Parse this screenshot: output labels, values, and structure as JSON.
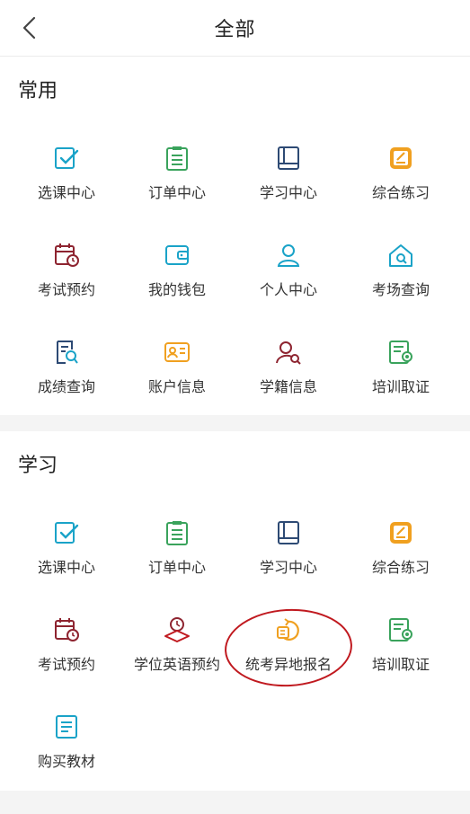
{
  "header": {
    "title": "全部"
  },
  "sections": [
    {
      "title": "常用",
      "items": [
        {
          "label": "选课中心",
          "icon": "checkbox-icon"
        },
        {
          "label": "订单中心",
          "icon": "clipboard-icon"
        },
        {
          "label": "学习中心",
          "icon": "book-icon"
        },
        {
          "label": "综合练习",
          "icon": "pencil-note-icon"
        },
        {
          "label": "考试预约",
          "icon": "calendar-clock-icon"
        },
        {
          "label": "我的钱包",
          "icon": "wallet-icon"
        },
        {
          "label": "个人中心",
          "icon": "user-icon"
        },
        {
          "label": "考场查询",
          "icon": "home-search-icon"
        },
        {
          "label": "成绩查询",
          "icon": "document-search-icon"
        },
        {
          "label": "账户信息",
          "icon": "id-card-icon"
        },
        {
          "label": "学籍信息",
          "icon": "user-search-icon"
        },
        {
          "label": "培训取证",
          "icon": "certificate-icon"
        }
      ]
    },
    {
      "title": "学习",
      "items": [
        {
          "label": "选课中心",
          "icon": "checkbox-icon"
        },
        {
          "label": "订单中心",
          "icon": "clipboard-icon"
        },
        {
          "label": "学习中心",
          "icon": "book-icon"
        },
        {
          "label": "综合练习",
          "icon": "pencil-note-icon"
        },
        {
          "label": "考试预约",
          "icon": "calendar-clock-icon"
        },
        {
          "label": "学位英语预约",
          "icon": "clock-book-icon"
        },
        {
          "label": "统考异地报名",
          "icon": "refresh-card-icon"
        },
        {
          "label": "培训取证",
          "icon": "certificate-icon"
        },
        {
          "label": "购买教材",
          "icon": "textbook-icon"
        }
      ]
    }
  ],
  "colors": {
    "cyan": "#1aa3c8",
    "green": "#3aa35c",
    "navy": "#2d4a74",
    "orange": "#f0a020",
    "maroon": "#8e2430",
    "highlight": "#c0191f"
  }
}
